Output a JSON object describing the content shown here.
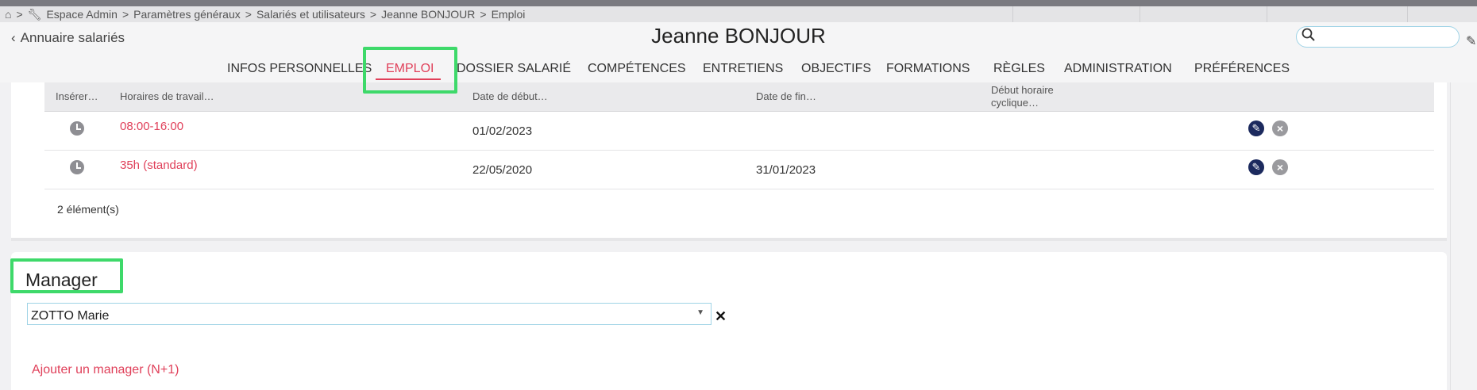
{
  "breadcrumb": {
    "items": [
      "Espace Admin",
      "Paramètres généraux",
      "Salariés et utilisateurs",
      "Jeanne BONJOUR",
      "Emploi"
    ],
    "separator": ">"
  },
  "header": {
    "back_label": "Annuaire salariés",
    "title": "Jeanne BONJOUR",
    "search_value": ""
  },
  "tabs": [
    {
      "label": "INFOS PERSONNELLES"
    },
    {
      "label": "EMPLOI"
    },
    {
      "label": "DOSSIER SALARIÉ"
    },
    {
      "label": "COMPÉTENCES"
    },
    {
      "label": "ENTRETIENS"
    },
    {
      "label": "OBJECTIFS"
    },
    {
      "label": "FORMATIONS"
    },
    {
      "label": "RÈGLES"
    },
    {
      "label": "ADMINISTRATION"
    },
    {
      "label": "PRÉFÉRENCES"
    }
  ],
  "active_tab": "EMPLOI",
  "schedule_table": {
    "columns": [
      "Insérer…",
      "Horaires de travail…",
      "Date de début…",
      "Date de fin…",
      "Début horaire cyclique…"
    ],
    "rows": [
      {
        "horaire": "08:00-16:00",
        "debut": "01/02/2023",
        "fin": ""
      },
      {
        "horaire": "35h (standard)",
        "debut": "22/05/2020",
        "fin": "31/01/2023"
      }
    ],
    "count_label": "2 élément(s)"
  },
  "manager": {
    "title": "Manager",
    "selected": "ZOTTO Marie",
    "add_label": "Ajouter un manager (N+1)"
  },
  "colors": {
    "accent": "#e0405a",
    "highlight": "#3ed96a",
    "edit_icon": "#1c2a5e"
  }
}
